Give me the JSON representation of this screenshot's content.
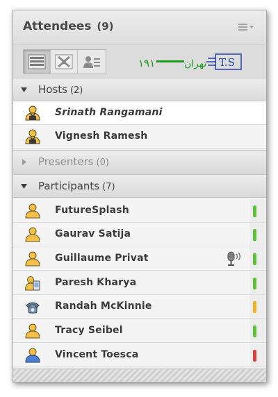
{
  "pod": {
    "title": "Attendees",
    "count": "(9)",
    "menu_icon": "pod-options-icon"
  },
  "toolbar": {
    "views": [
      {
        "name": "list-view",
        "icon": "list-view-icon",
        "active": true
      },
      {
        "name": "breakout-view",
        "icon": "breakout-view-icon",
        "active": false
      },
      {
        "name": "status-view",
        "icon": "status-view-icon",
        "active": false
      }
    ],
    "watermark": {
      "letters": "T.S",
      "arabic": "تهران"
    }
  },
  "sections": {
    "hosts": {
      "label": "Hosts",
      "count": "(2)",
      "expanded": true
    },
    "presenters": {
      "label": "Presenters",
      "count": "(0)",
      "expanded": false
    },
    "participants": {
      "label": "Participants",
      "count": "(7)",
      "expanded": true
    }
  },
  "hosts": [
    {
      "name": "Srinath Rangamani",
      "icon": "host-icon",
      "italic": true
    },
    {
      "name": "Vignesh Ramesh",
      "icon": "host-icon",
      "italic": false
    }
  ],
  "participants": [
    {
      "name": "FutureSplash",
      "icon": "participant-icon",
      "status": "green"
    },
    {
      "name": "Gaurav Satija",
      "icon": "participant-icon",
      "status": "green"
    },
    {
      "name": "Guillaume Privat",
      "icon": "participant-icon",
      "status": "green",
      "mic": true
    },
    {
      "name": "Paresh Kharya",
      "icon": "mobile-participant-icon",
      "status": "green"
    },
    {
      "name": "Randah McKinnie",
      "icon": "phone-participant-icon",
      "status": "yellow"
    },
    {
      "name": "Tracy Seibel",
      "icon": "participant-icon",
      "status": "green"
    },
    {
      "name": "Vincent Toesca",
      "icon": "participant-blue-icon",
      "status": "red"
    }
  ],
  "colors": {
    "green": "#5fc23d",
    "yellow": "#f2b12b",
    "red": "#d94141",
    "watermark": "#1e9a1e",
    "watermark_blue": "#2244aa"
  }
}
